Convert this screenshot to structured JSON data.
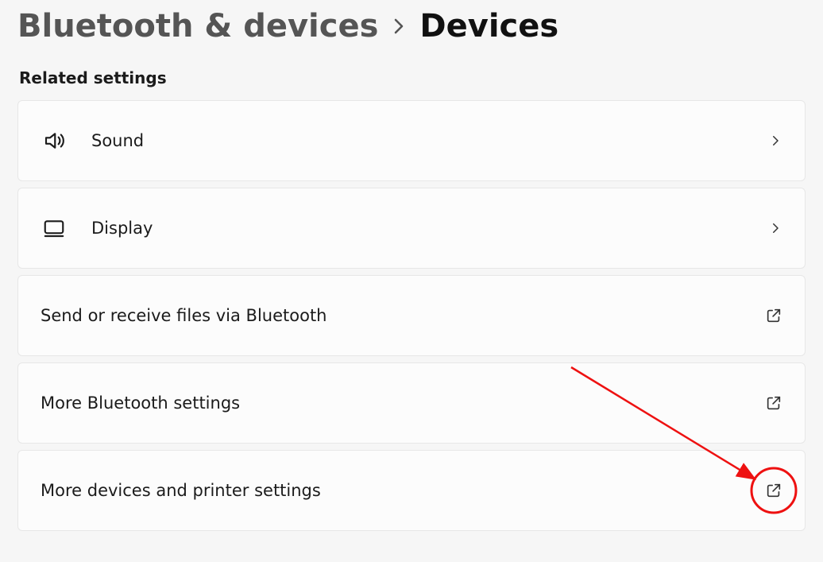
{
  "breadcrumb": {
    "parent": "Bluetooth & devices",
    "current": "Devices"
  },
  "section_title": "Related settings",
  "cards": [
    {
      "icon": "sound-icon",
      "label": "Sound",
      "action": "chevron"
    },
    {
      "icon": "display-icon",
      "label": "Display",
      "action": "chevron"
    },
    {
      "icon": null,
      "label": "Send or receive files via Bluetooth",
      "action": "external"
    },
    {
      "icon": null,
      "label": "More Bluetooth settings",
      "action": "external"
    },
    {
      "icon": null,
      "label": "More devices and printer settings",
      "action": "external"
    }
  ],
  "annotation": {
    "target_card_index": 4,
    "circle_color": "#e11",
    "arrow_color": "#e11"
  }
}
